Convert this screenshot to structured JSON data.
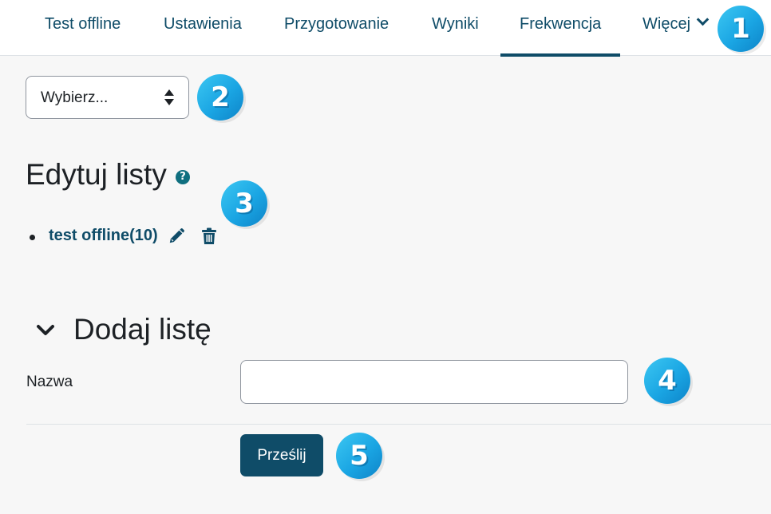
{
  "nav": {
    "tabs": [
      {
        "label": "Test offline"
      },
      {
        "label": "Ustawienia"
      },
      {
        "label": "Przygotowanie"
      },
      {
        "label": "Wyniki"
      },
      {
        "label": "Frekwencja"
      },
      {
        "label": "Więcej"
      }
    ],
    "active_tab": "Frekwencja"
  },
  "select": {
    "value": "Wybierz..."
  },
  "edit_section": {
    "heading": "Edytuj listy",
    "help_icon": "?",
    "lists": [
      {
        "label": "test offline(10)"
      }
    ]
  },
  "add_section": {
    "heading": "Dodaj listę",
    "name_label": "Nazwa",
    "name_value": "",
    "submit_label": "Prześlij"
  },
  "badges": [
    "1",
    "2",
    "3",
    "4",
    "5"
  ],
  "colors": {
    "accent": "#0f4c68",
    "badge": "#1aa5e3",
    "background": "#f7f7f7"
  },
  "icons": [
    "pencil-icon",
    "trash-icon",
    "chevron-down-icon",
    "sort-icon",
    "help-icon"
  ]
}
